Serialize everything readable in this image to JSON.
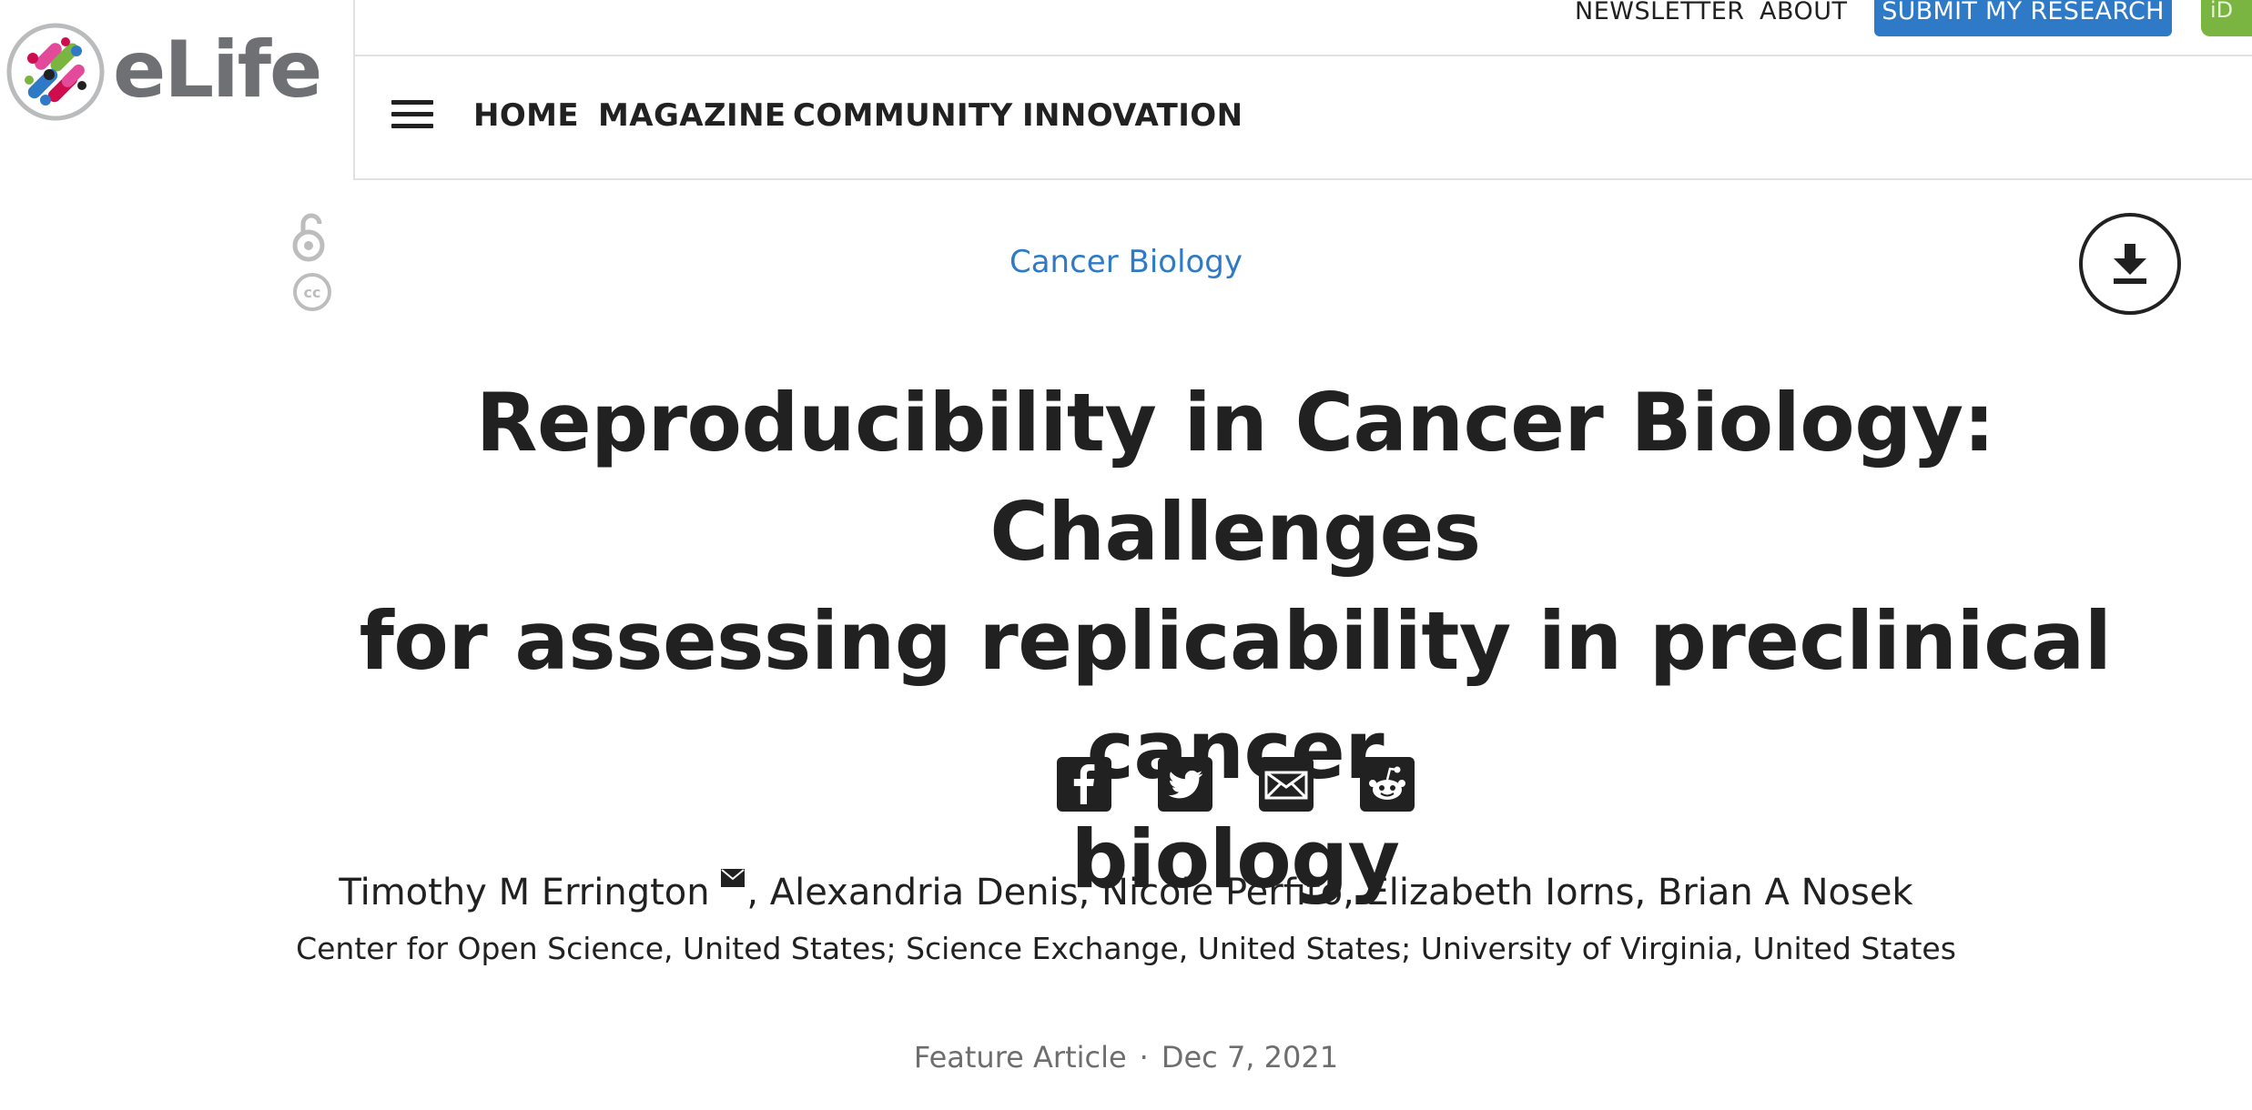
{
  "brand": {
    "name": "eLife"
  },
  "top_links": {
    "newsletter": "NEWSLETTER",
    "about": "ABOUT",
    "submit": "SUBMIT MY RESEARCH",
    "orcid": "iD"
  },
  "nav": {
    "items": [
      "HOME",
      "MAGAZINE",
      "COMMUNITY",
      "INNOVATION"
    ]
  },
  "article": {
    "subject": "Cancer Biology",
    "title_lines": [
      "Reproducibility in Cancer Biology: Challenges",
      "for assessing replicability in preclinical cancer",
      "biology"
    ],
    "authors": [
      "Timothy M Errington",
      "Alexandria Denis",
      "Nicole Perfito",
      "Elizabeth Iorns",
      "Brian A Nosek"
    ],
    "affiliations": "Center for Open Science, United States; Science Exchange, United States; University of Virginia, United States",
    "type": "Feature Article",
    "separator": "·",
    "date": "Dec 7, 2021"
  },
  "share": [
    "facebook-icon",
    "twitter-icon",
    "email-icon",
    "reddit-icon"
  ],
  "colors": {
    "accent": "#2e7ac7",
    "orcid": "#7bb541",
    "text": "#212121",
    "muted": "#6e6e6e",
    "logo_text": "#6e7073"
  }
}
